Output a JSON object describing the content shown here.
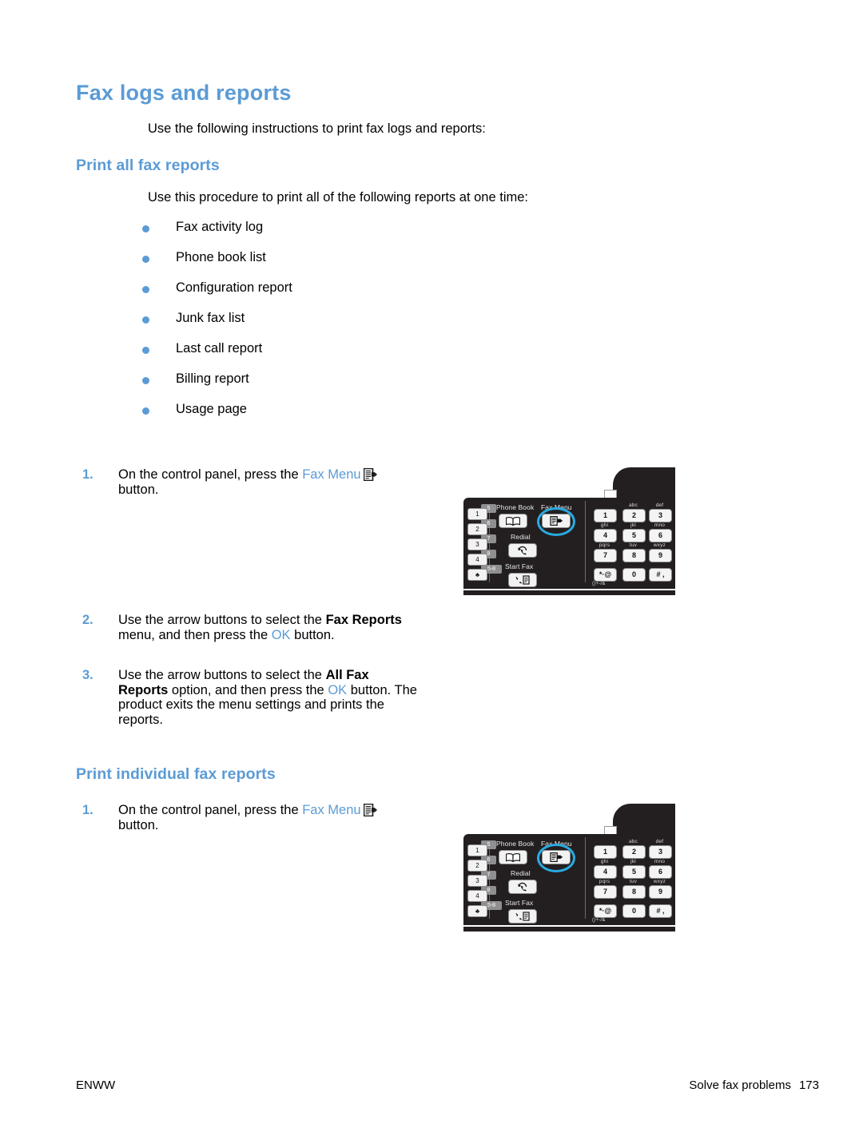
{
  "document": {
    "heading": "Fax logs and reports",
    "intro": "Use the following instructions to print fax logs and reports:"
  },
  "sections": [
    {
      "heading": "Print all fax reports",
      "intro": "Use this procedure to print all of the following reports at one time:",
      "bullets": [
        "Fax activity log",
        "Phone book list",
        "Configuration report",
        "Junk fax list",
        "Last call report",
        "Billing report",
        "Usage page"
      ]
    },
    {
      "heading": "Print individual fax reports"
    }
  ],
  "steps_all": [
    {
      "number": "1.",
      "pre": "On the control panel, press the ",
      "link": "Fax Menu",
      "post": " button."
    },
    {
      "number": "2.",
      "pre": "Use the arrow buttons to select the ",
      "bold": "Fax Reports",
      "mid": " menu, and then press the ",
      "link": "OK",
      "post": " button."
    },
    {
      "number": "3.",
      "pre": "Use the arrow buttons to select the ",
      "bold": "All Fax Reports",
      "mid": " option, and then press the ",
      "link": "OK",
      "post": " button. The product exits the menu settings and prints the reports."
    }
  ],
  "steps_individual": [
    {
      "number": "1.",
      "pre": "On the control panel, press the ",
      "link": "Fax Menu",
      "post": " button."
    }
  ],
  "control_panel": {
    "speed_dial": [
      {
        "key": "1",
        "tag": "5"
      },
      {
        "key": "2",
        "tag": "6"
      },
      {
        "key": "3",
        "tag": "7"
      },
      {
        "key": "4",
        "tag": "8"
      },
      {
        "key": "♣",
        "tag": "5-8"
      }
    ],
    "function_buttons": [
      {
        "label": "Phone Book",
        "icon": "phone-book-icon"
      },
      {
        "label": "Fax Menu",
        "icon": "fax-menu-icon",
        "highlighted": true
      },
      {
        "label": "Redial",
        "icon": "redial-icon"
      },
      {
        "label": "Start Fax",
        "icon": "start-fax-icon"
      }
    ],
    "keypad": [
      {
        "digit": "1",
        "letters": ""
      },
      {
        "digit": "2",
        "letters": "abc"
      },
      {
        "digit": "3",
        "letters": "def"
      },
      {
        "digit": "4",
        "letters": "ghi"
      },
      {
        "digit": "5",
        "letters": "jkl"
      },
      {
        "digit": "6",
        "letters": "mno"
      },
      {
        "digit": "7",
        "letters": "pqrs"
      },
      {
        "digit": "8",
        "letters": "tuv"
      },
      {
        "digit": "9",
        "letters": "wxyz"
      },
      {
        "digit": "*·@",
        "letters": ""
      },
      {
        "digit": "0",
        "letters": ""
      },
      {
        "digit": "# ,",
        "letters": ""
      }
    ],
    "symbol_row": "()+-/&"
  },
  "footer": {
    "left": "ENWW",
    "right": "Solve fax problems",
    "page": "173"
  },
  "colors": {
    "heading_blue": "#5B9BD5",
    "highlight_blue": "#29ABE2",
    "panel_dark": "#231f20"
  }
}
